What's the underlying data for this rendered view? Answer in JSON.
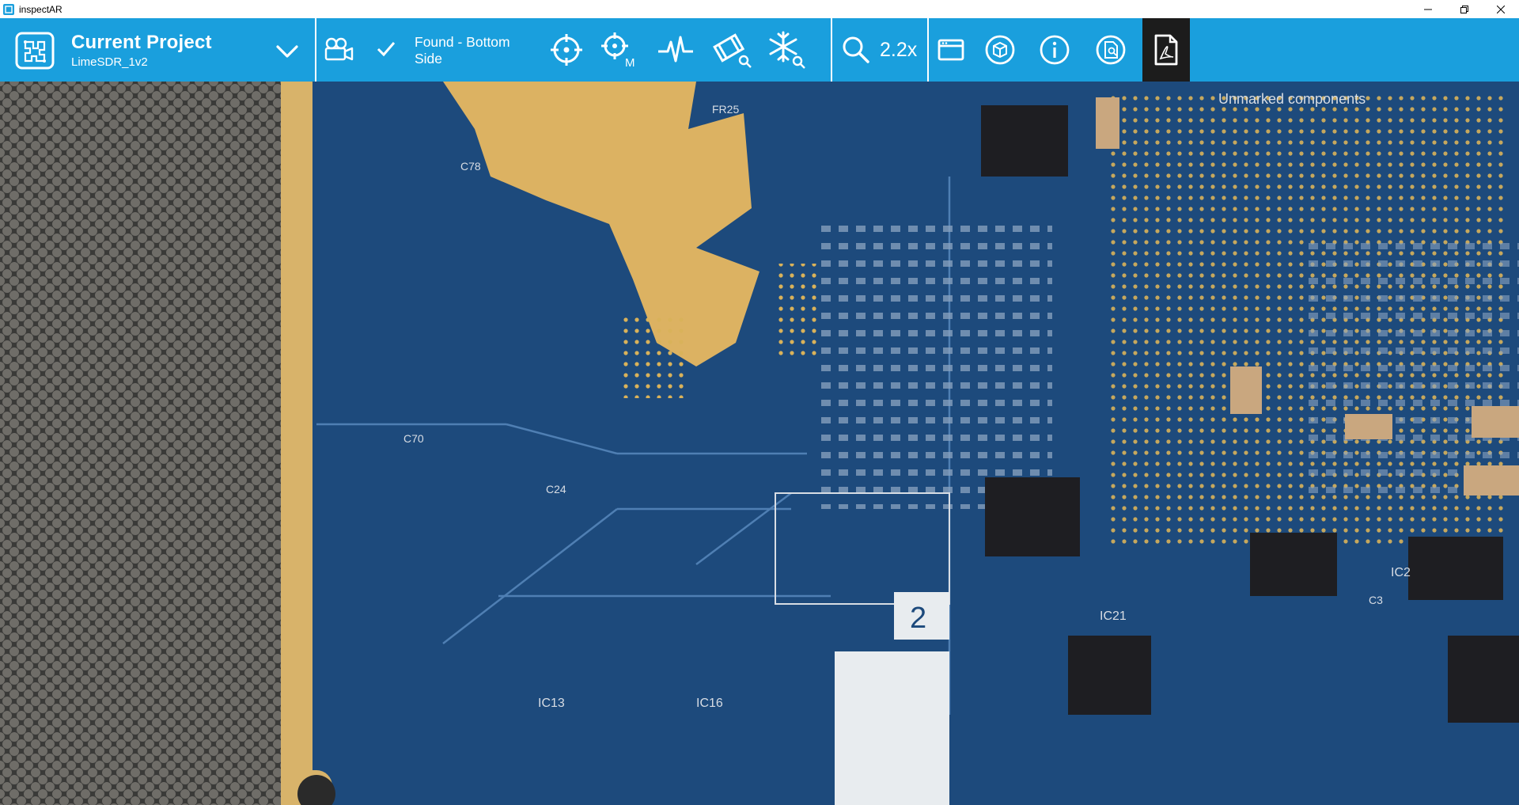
{
  "window": {
    "title": "inspectAR",
    "icons": [
      "app-icon",
      "minimize-icon",
      "restore-icon",
      "close-icon"
    ]
  },
  "toolbar": {
    "project_title": "Current Project",
    "project_name": "LimeSDR_1v2",
    "tracking_status": "Found - Bottom Side",
    "zoom_level": "2.2x",
    "icons": [
      "logo-icon",
      "chevron-down-icon",
      "camera-icon",
      "checkmark-icon",
      "crosshair-icon",
      "crosshair-m-icon",
      "waveform-icon",
      "component-search-icon",
      "freeze-search-icon",
      "zoom-icon",
      "window-icon",
      "3d-box-icon",
      "info-icon",
      "document-search-icon",
      "pdf-icon"
    ],
    "colors": {
      "bar": "#1a9fdd",
      "pdf_active": "#1c1c1c",
      "text": "#ffffff"
    },
    "badge_m": "M"
  },
  "camera_view": {
    "content": "PCB camera feed",
    "silkscreen": [
      "Unmarked components",
      "2",
      "IC21",
      "IC13",
      "IC16",
      "C24",
      "C70",
      "C78",
      "FR25",
      "IC2",
      "C3"
    ]
  }
}
